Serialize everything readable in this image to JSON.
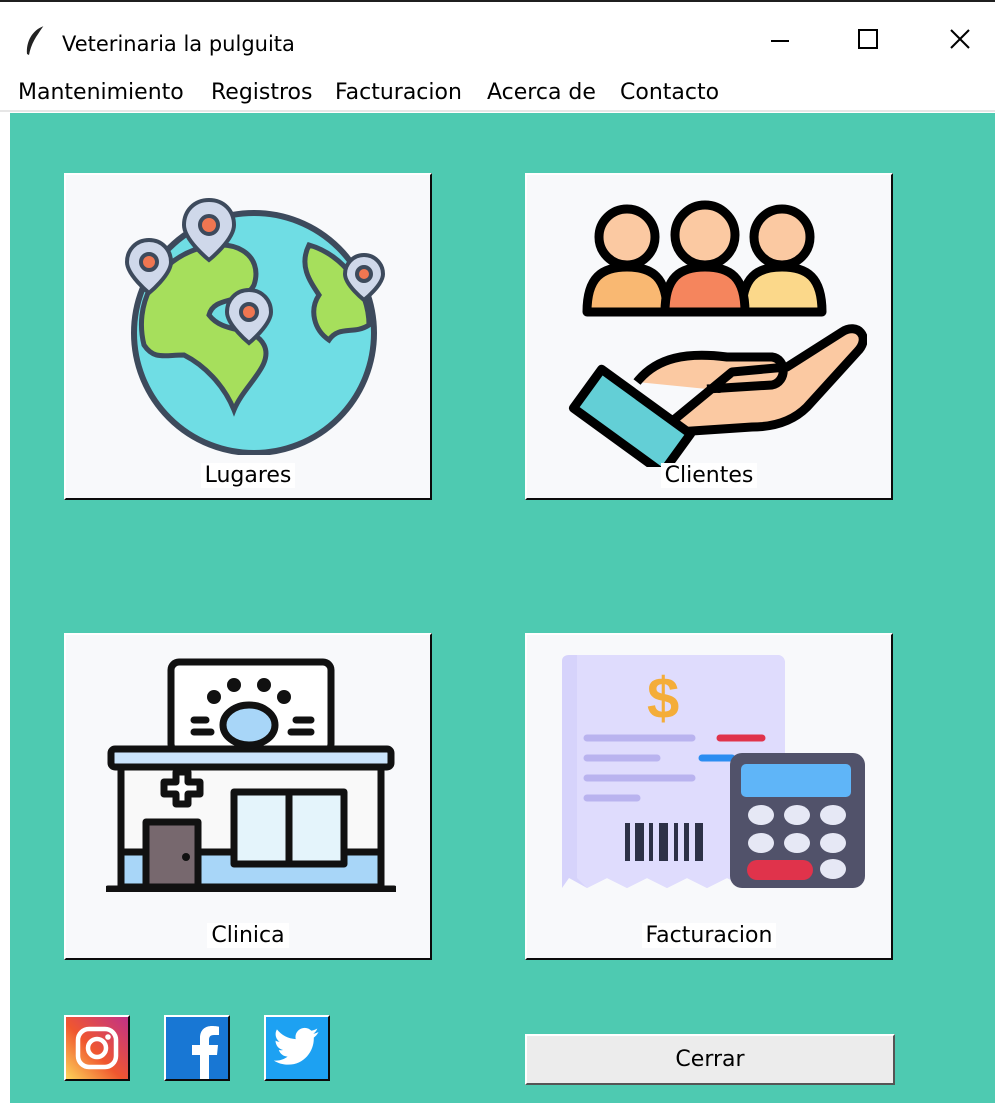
{
  "window": {
    "title": "Veterinaria la pulguita"
  },
  "menu": [
    {
      "label": "Mantenimiento"
    },
    {
      "label": "Registros"
    },
    {
      "label": "Facturacion"
    },
    {
      "label": "Acerca de"
    },
    {
      "label": "Contacto"
    }
  ],
  "tiles": {
    "lugares": {
      "label": "Lugares",
      "icon": "globe-map-pins-icon"
    },
    "clientes": {
      "label": "Clientes",
      "icon": "people-hand-icon"
    },
    "clinica": {
      "label": "Clinica",
      "icon": "vet-clinic-building-icon"
    },
    "facturacion": {
      "label": "Facturacion",
      "icon": "invoice-calculator-icon"
    }
  },
  "social": [
    "instagram-icon",
    "facebook-icon",
    "twitter-icon"
  ],
  "close_button": {
    "label": "Cerrar"
  },
  "colors": {
    "background": "#4ecab1",
    "tile": "#f8f9fb",
    "button": "#ececec"
  }
}
